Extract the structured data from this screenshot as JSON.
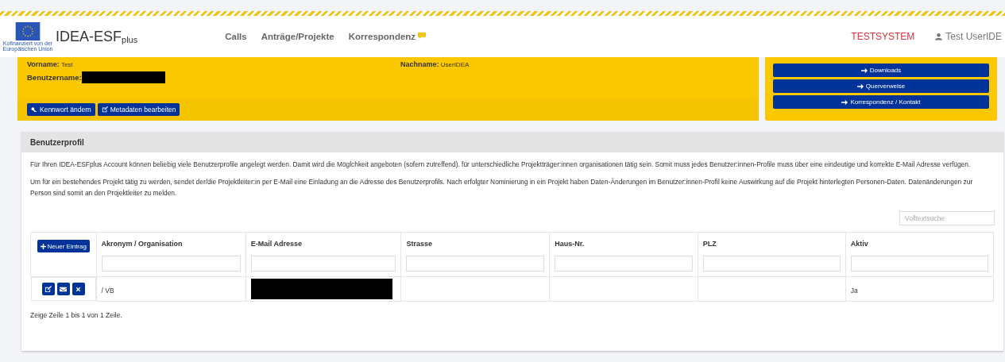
{
  "header": {
    "logo_caption": "Kofinanziert von der Europäischen Union",
    "app_name": "IDEA-ESF$_{plus}$",
    "nav": [
      {
        "label": "Calls",
        "badge": false
      },
      {
        "label": "Anträge/Projekte",
        "badge": false
      },
      {
        "label": "Korrespondenz",
        "badge": true
      }
    ],
    "system_label": "TESTSYSTEM",
    "user": "Test UserIDE"
  },
  "user_panel": {
    "fields": [
      {
        "label": "Vorname:",
        "value": "Test"
      },
      {
        "label": "Nachname:",
        "value": "UserIDEA"
      }
    ],
    "username_label": "Benutzername:",
    "buttons": [
      {
        "label": "Kennwort ändern",
        "kind": "key"
      },
      {
        "label": "Metadaten bearbeiten",
        "kind": "edit"
      }
    ]
  },
  "links": [
    "Downloads",
    "Querverweise",
    "Korrespondenz / Kontakt"
  ],
  "profile": {
    "title": "Benutzerprofil",
    "paragraphs": [
      "Für Ihren IDEA-ESFplus Account können beliebig viele Benutzerprofile angelegt werden. Damit wird die Möglchkeit angeboten (sofern zutreffend). für unterschiedliche Projektträger:innen organisationen tätig sein. Somit muss jedes Benutzer:innen-Profile muss über eine eindeutige und korrekte E-Mail Adresse verfügen.",
      "Um für ein bestehendes Projekt tätig zu werden, sendet der/die Projektleiter:in per E-Mail eine Einladung an die Adresse des Benutzerprofils.  Nach erfolgter Nominierung in ein Projekt haben Daten-Änderungen im Benutzer:innen-Profil keine Auswirkung auf die Projekt hinterlegten Personen-Daten. Datenänderungen zur Person sind somit an den Projektleiter zu melden."
    ],
    "search": {
      "placeholder": "Volltextsuche"
    },
    "table": {
      "new_button": "Neuer Eintrag",
      "columns": [
        "Akronym / Organisation",
        "E-Mail Adresse",
        "Strasse",
        "Haus-Nr.",
        "PLZ",
        "Aktiv"
      ],
      "rows": [
        {
          "cells": [
            "/ VB",
            "",
            "",
            "",
            "",
            "Ja"
          ]
        }
      ]
    },
    "footer": "Zeige Zeile 1 bis 1 von 1 Zeile."
  }
}
